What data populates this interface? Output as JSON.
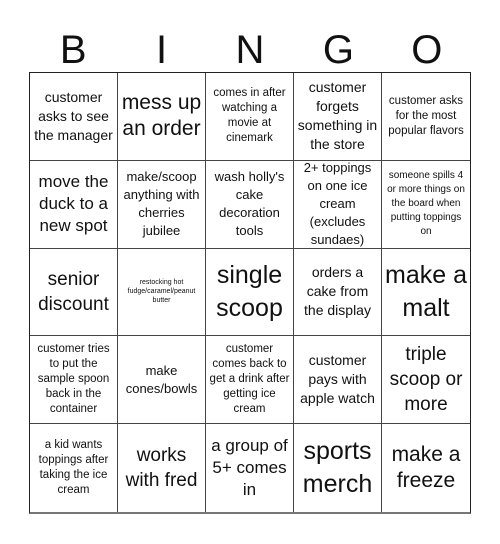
{
  "header": {
    "letters": [
      "B",
      "I",
      "N",
      "G",
      "O"
    ]
  },
  "board": {
    "rows": [
      [
        {
          "text": "customer asks to see the manager"
        },
        {
          "text": "mess up an order"
        },
        {
          "text": "comes in after watching a movie at cinemark"
        },
        {
          "text": "customer forgets something in the store"
        },
        {
          "text": "customer asks for the most popular flavors"
        }
      ],
      [
        {
          "text": "move the duck to a new spot"
        },
        {
          "text": "make/scoop anything with cherries jubilee"
        },
        {
          "text": "wash holly's cake decoration tools"
        },
        {
          "text": "2+ toppings on one ice cream (excludes sundaes)"
        },
        {
          "text": "someone spills 4 or more things on the board when putting toppings on"
        }
      ],
      [
        {
          "text": "senior discount"
        },
        {
          "text": "restocking hot fudge/caramel/peanut butter"
        },
        {
          "text": "single scoop"
        },
        {
          "text": "orders a cake from the display"
        },
        {
          "text": "make a malt"
        }
      ],
      [
        {
          "text": "customer tries to put the sample spoon back in the container"
        },
        {
          "text": "make cones/bowls"
        },
        {
          "text": "customer comes back to get a drink after getting ice cream"
        },
        {
          "text": "customer pays with apple watch"
        },
        {
          "text": "triple scoop or more"
        }
      ],
      [
        {
          "text": "a kid wants toppings after taking the ice cream"
        },
        {
          "text": "works with fred"
        },
        {
          "text": "a group of 5+ comes in"
        },
        {
          "text": "sports merch"
        },
        {
          "text": "make a freeze"
        }
      ]
    ]
  }
}
